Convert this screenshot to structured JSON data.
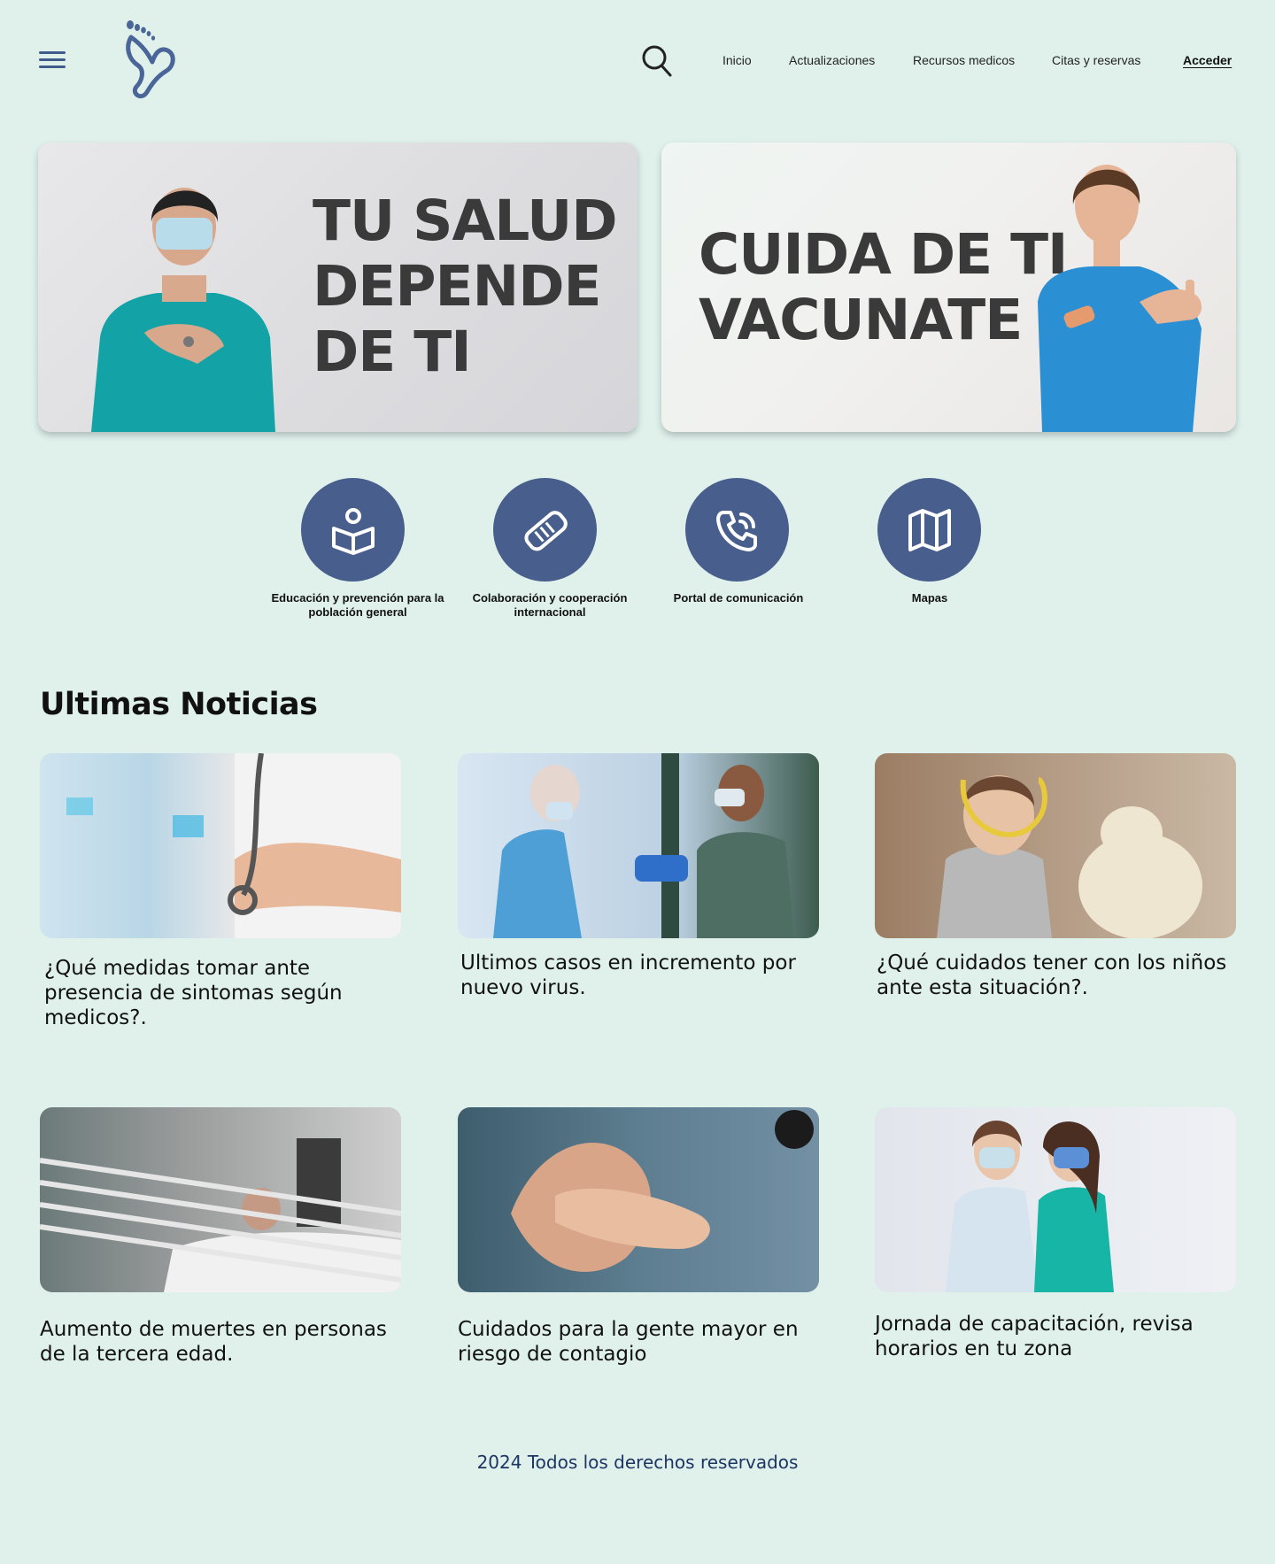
{
  "header": {
    "logo_alt": "heart-footprint-logo",
    "nav": [
      {
        "label": "Inicio"
      },
      {
        "label": "Actualizaciones"
      },
      {
        "label": "Recursos medicos"
      },
      {
        "label": "Citas y reservas"
      }
    ],
    "login_label": "Acceder"
  },
  "banners": [
    {
      "title": "TU SALUD\nDEPENDE\nDE TI"
    },
    {
      "title": "CUIDA DE TI\nVACUNATE"
    }
  ],
  "quick_links": [
    {
      "label": "Educación y prevención para la población general",
      "icon": "education-icon"
    },
    {
      "label": "Colaboración y cooperación internacional",
      "icon": "handshake-icon"
    },
    {
      "label": "Portal de comunicación",
      "icon": "phone-icon"
    },
    {
      "label": "Mapas",
      "icon": "map-icon"
    }
  ],
  "news": {
    "section_title": "Ultimas Noticias",
    "items": [
      {
        "title": "¿Qué medidas tomar ante presencia de sintomas según medicos?."
      },
      {
        "title": "Ultimos casos en incremento por nuevo virus."
      },
      {
        "title": "¿Qué cuidados tener con los niños ante esta situación?."
      },
      {
        "title": "Aumento de muertes en personas de la tercera edad."
      },
      {
        "title": "Cuidados para la gente mayor en riesgo de contagio"
      },
      {
        "title": "Jornada de capacitación, revisa horarios en tu zona"
      }
    ]
  },
  "footer": {
    "text": "2024 Todos los derechos reservados"
  },
  "colors": {
    "background": "#e0f1ec",
    "accent": "#485e8c",
    "footer_text": "#1c3563"
  }
}
